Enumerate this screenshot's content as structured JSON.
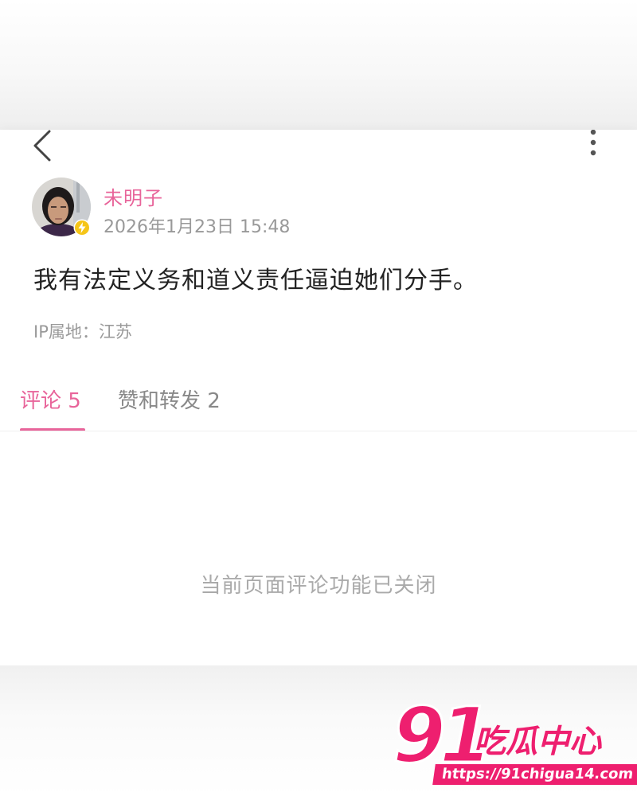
{
  "post": {
    "author": "未明子",
    "timestamp": "2026年1月23日 15:48",
    "text": "我有法定义务和道义责任逼迫她们分手。",
    "ip_location": "IP属地：江苏"
  },
  "tabs": [
    {
      "label": "评论 5",
      "active": true
    },
    {
      "label": "赞和转发 2",
      "active": false
    }
  ],
  "comments_closed_message": "当前页面评论功能已关闭",
  "watermark": {
    "number": "91",
    "text": "吃瓜中心",
    "url": "https://91chigua14.com"
  },
  "colors": {
    "accent": "#e8649a",
    "watermark": "#ee1f6f",
    "badge": "#f5c518"
  },
  "icons": [
    "back-arrow-icon",
    "more-vertical-icon",
    "lightning-badge-icon"
  ]
}
